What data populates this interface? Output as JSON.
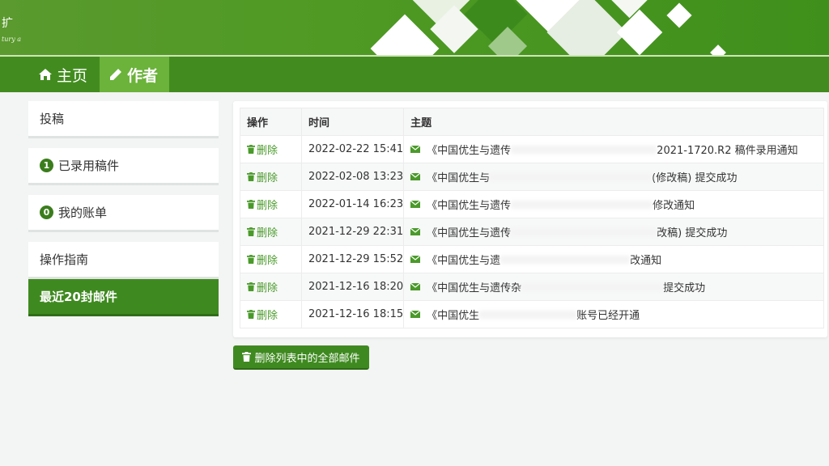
{
  "banner": {
    "logo_text": "扩",
    "logo_sub": "tury a"
  },
  "nav": {
    "home_label": "主页",
    "author_label": "作者"
  },
  "sidebar": {
    "items": [
      {
        "label": "投稿"
      },
      {
        "label": "已录用稿件",
        "badge": "1"
      },
      {
        "label": "我的账单",
        "badge": "0"
      },
      {
        "label": "操作指南"
      },
      {
        "label": "最近20封邮件",
        "active": true
      }
    ]
  },
  "table": {
    "headers": {
      "op": "操作",
      "time": "时间",
      "subject": "主题"
    },
    "rows": [
      {
        "op": "删除",
        "time": "2022-02-22 15:41",
        "subject_start": "《中国优生与遗传",
        "subject_end": "2021-1720.R2 稿件录用通知"
      },
      {
        "op": "删除",
        "time": "2022-02-08 13:23",
        "subject_start": "《中国优生与",
        "subject_end": "(修改稿) 提交成功"
      },
      {
        "op": "删除",
        "time": "2022-01-14 16:23",
        "subject_start": "《中国优生与遗传",
        "subject_end": "修改通知"
      },
      {
        "op": "删除",
        "time": "2021-12-29 22:31",
        "subject_start": "《中国优生与遗传",
        "subject_end": "改稿) 提交成功"
      },
      {
        "op": "删除",
        "time": "2021-12-29 15:52",
        "subject_start": "《中国优生与遗",
        "subject_end": "改通知"
      },
      {
        "op": "删除",
        "time": "2021-12-16 18:20",
        "subject_start": "《中国优生与遗传杂",
        "subject_end": "提交成功"
      },
      {
        "op": "删除",
        "time": "2021-12-16 18:15",
        "subject_start": "《中国优生",
        "subject_end": "账号已经开通"
      }
    ]
  },
  "delete_all_label": "删除列表中的全部邮件",
  "colors": {
    "accent": "#3f8a20",
    "link": "#4a9a2a",
    "banner": "#4f9a24"
  }
}
